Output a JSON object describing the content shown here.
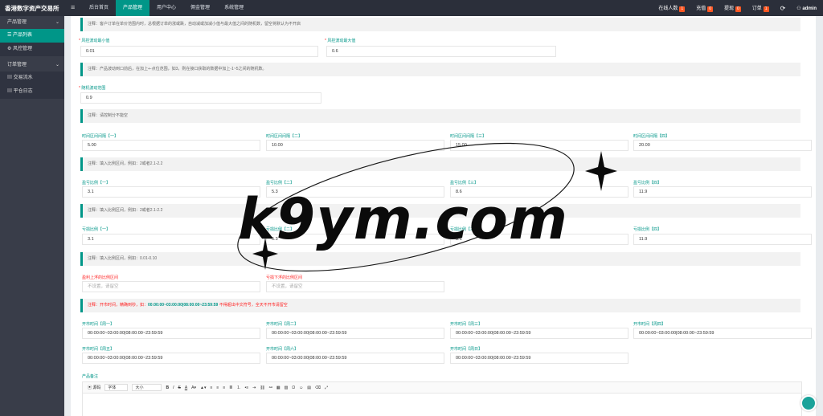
{
  "header": {
    "brand": "香港数字资产交易所",
    "nav": [
      "后台首页",
      "产品管理",
      "用户中心",
      "佣金管理",
      "系统管理"
    ],
    "right": [
      {
        "label": "在线人数",
        "badge": "1"
      },
      {
        "label": "充值",
        "badge": "0"
      },
      {
        "label": "提现",
        "badge": "0"
      },
      {
        "label": "订单",
        "badge": "1"
      }
    ],
    "user": "admin"
  },
  "sidebar": {
    "group1": "产品管理",
    "items1": [
      "产品列表",
      "风控管理"
    ],
    "group2": "订单管理",
    "items2": [
      "交易流水",
      "平仓日志"
    ]
  },
  "form": {
    "note1": "注释：客户订单在单价范围内时，总根据订单的涨或跌，自动减或加减小值与最大值之间的随机数，留空将默认为不开启",
    "min_label": "风控波动最小值",
    "min_value": "0.01",
    "max_label": "风控波动最大值",
    "max_value": "0.6",
    "note2": "注释：产品波动到口前后，在加上+-点位范围，如3，则在接口获取的数据中加上-1~5之间的随机数。",
    "range_label": "随机波动范围",
    "range_value": "0.9",
    "note3": "注释：请控制分不能空",
    "interval_labels": [
      "时间区间间隔【一】",
      "时间区间间隔【二】",
      "时间区间间隔【三】",
      "时间区间间隔【四】"
    ],
    "interval_values": [
      "5.00",
      "10.00",
      "15.00",
      "20.00"
    ],
    "note4": "注释：填入比例区间，例如：2或者2.1-2.2",
    "profit_labels": [
      "盈亏比例【一】",
      "盈亏比例【二】",
      "盈亏比例【三】",
      "盈亏比例【四】"
    ],
    "profit_values": [
      "3.1",
      "5.3",
      "8.6",
      "11.9"
    ],
    "note5": "注释：填入比例区间，例如：2或者2.1-2.2",
    "loss_labels": [
      "亏损比例【一】",
      "亏损比例【二】",
      "亏损比例【三】",
      "亏损比例【四】"
    ],
    "loss_values": [
      "3.1",
      "5.3",
      "8.6",
      "11.9"
    ],
    "note6": "注释：填入比例区间，例如：0.01-0.10",
    "float_labels": [
      "盈利上浮的比例区间",
      "亏损下浮的比例区间"
    ],
    "float_placeholders": [
      "不设置，请留空",
      "不设置，请留空"
    ],
    "note7_a": "注释：开市时间，精确到秒，如：",
    "note7_b": "00:00:00~03:00:00|08:00:00~23:59:59",
    "note7_c": " 不得超出中文符号，全天不开市请留空",
    "open_labels_row1": [
      "开市时间【周一】",
      "开市时间【周二】",
      "开市时间【周三】",
      "开市时间【周四】"
    ],
    "open_values_row1": [
      "00:00:00~03:00:00|08:00:00~23:59:59",
      "00:00:00~03:00:00|08:00:00~23:59:59",
      "00:00:00~03:00:00|08:00:00~23:59:59",
      "00:00:00~03:00:00|08:00:00~23:59:59"
    ],
    "open_labels_row2": [
      "开市时间【周五】",
      "开市时间【周六】",
      "开市时间【周日】"
    ],
    "open_values_row2": [
      "00:00:00~03:00:00|08:00:00~23:59:59",
      "00:00:00~03:00:00|08:00:00~23:59:59",
      "00:00:00~03:00:00|08:00:00~23:59:59"
    ],
    "remark_label": "产品备注"
  },
  "editor": {
    "source": "源码",
    "font": "字体",
    "size": "大小"
  },
  "watermark": "k9ym.com"
}
